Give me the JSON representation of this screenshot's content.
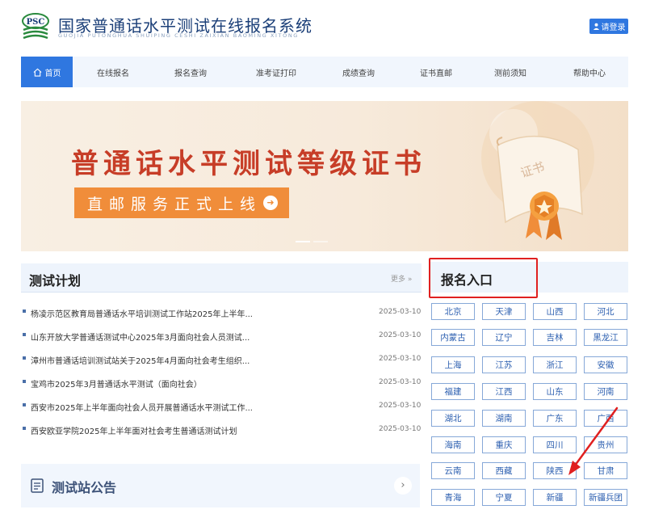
{
  "header": {
    "title": "国家普通话水平测试在线报名系统",
    "pinyin": "GUOJIA PUTONGHUA SHUIPING CESHI ZAIXIAN BAOMING XITONG",
    "logo_text": "PSC",
    "login_label": "请登录"
  },
  "nav": {
    "items": [
      {
        "label": "首页",
        "active": true
      },
      {
        "label": "在线报名"
      },
      {
        "label": "报名查询"
      },
      {
        "label": "准考证打印"
      },
      {
        "label": "成绩查询"
      },
      {
        "label": "证书直邮"
      },
      {
        "label": "测前须知"
      },
      {
        "label": "帮助中心"
      }
    ]
  },
  "banner": {
    "title": "普通话水平测试等级证书",
    "subtitle": "直邮服务正式上线",
    "scroll_text": "证书"
  },
  "plan": {
    "title": "测试计划",
    "more": "更多 »",
    "rows": [
      {
        "text": "杨凌示范区教育局普通话水平培训测试工作站2025年上半年...",
        "date": "2025-03-10"
      },
      {
        "text": "山东开放大学普通话测试中心2025年3月面向社会人员测试...",
        "date": "2025-03-10"
      },
      {
        "text": "漳州市普通话培训测试站关于2025年4月面向社会考生组织...",
        "date": "2025-03-10"
      },
      {
        "text": "宝鸡市2025年3月普通话水平测试（面向社会）",
        "date": "2025-03-10"
      },
      {
        "text": "西安市2025年上半年面向社会人员开展普通话水平测试工作...",
        "date": "2025-03-10"
      },
      {
        "text": "西安欧亚学院2025年上半年面对社会考生普通话测试计划",
        "date": "2025-03-10"
      }
    ]
  },
  "notice": {
    "title": "测试站公告",
    "arrow": "›"
  },
  "registration": {
    "title": "报名入口",
    "provinces": [
      "北京",
      "天津",
      "山西",
      "河北",
      "内蒙古",
      "辽宁",
      "吉林",
      "黑龙江",
      "上海",
      "江苏",
      "浙江",
      "安徽",
      "福建",
      "江西",
      "山东",
      "河南",
      "湖北",
      "湖南",
      "广东",
      "广西",
      "海南",
      "重庆",
      "四川",
      "贵州",
      "云南",
      "西藏",
      "陕西",
      "甘肃",
      "青海",
      "宁夏",
      "新疆",
      "新疆兵团"
    ]
  },
  "colors": {
    "primary": "#2f77e0",
    "highlight": "#e02020",
    "banner_title": "#c73d27",
    "banner_sub": "#f08d3a"
  }
}
